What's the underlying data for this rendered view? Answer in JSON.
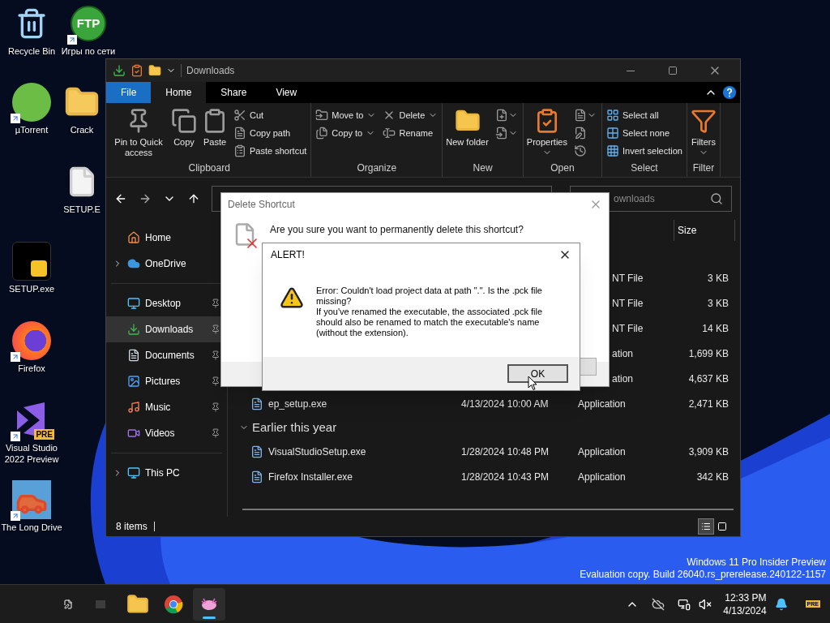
{
  "desktop_icons": [
    {
      "label": "Recycle Bin",
      "kind": "recycle",
      "shortcut": false
    },
    {
      "label": "µTorrent",
      "kind": "torrent",
      "shortcut": true
    },
    {
      "label": "SETUP.exe",
      "kind": "setup",
      "shortcut": false
    },
    {
      "label": "Firefox",
      "kind": "firefox",
      "shortcut": true
    },
    {
      "label": "Visual Studio 2022 Preview",
      "kind": "vs",
      "logo_text": "PRE",
      "shortcut": true
    },
    {
      "label": "The Long Drive",
      "kind": "car",
      "shortcut": true
    },
    {
      "label": "Игры по сети",
      "kind": "ftp",
      "logo_text": "FTP",
      "shortcut": true
    },
    {
      "label": "Crack",
      "kind": "folder",
      "shortcut": false
    },
    {
      "label": "SETUP.E",
      "kind": "file",
      "shortcut": false
    }
  ],
  "explorer": {
    "title": "Downloads",
    "tabs": [
      {
        "label": "File",
        "kind": "file",
        "selected": false
      },
      {
        "label": "Home",
        "kind": "tab",
        "selected": true
      },
      {
        "label": "Share",
        "kind": "tab",
        "selected": false
      },
      {
        "label": "View",
        "kind": "tab",
        "selected": false
      }
    ],
    "ribbon": [
      {
        "label": "Clipboard",
        "items": [
          {
            "kind": "large",
            "label": "Pin to Quick access",
            "dropdown": false
          },
          {
            "kind": "large",
            "label": "Copy",
            "dropdown": false
          },
          {
            "kind": "large",
            "label": "Paste",
            "dropdown": false
          },
          {
            "kind": "small",
            "label": "Cut",
            "dropdown": false
          },
          {
            "kind": "small",
            "label": "Copy path",
            "dropdown": false
          },
          {
            "kind": "small",
            "label": "Paste shortcut",
            "dropdown": false
          }
        ]
      },
      {
        "label": "Organize",
        "items": [
          {
            "kind": "small",
            "label": "Move to",
            "dropdown": true
          },
          {
            "kind": "small",
            "label": "Copy to",
            "dropdown": true
          },
          {
            "kind": "small",
            "label": "Delete",
            "dropdown": true
          },
          {
            "kind": "small",
            "label": "Rename",
            "dropdown": false
          }
        ]
      },
      {
        "label": "New",
        "items": [
          {
            "kind": "large",
            "label": "New folder",
            "dropdown": false
          },
          {
            "kind": "icon",
            "dropdown": true
          },
          {
            "kind": "icon",
            "dropdown": true
          }
        ]
      },
      {
        "label": "Open",
        "items": [
          {
            "kind": "large",
            "label": "Properties",
            "dropdown": true
          },
          {
            "kind": "icon",
            "dropdown": true
          },
          {
            "kind": "icon",
            "dropdown": false
          },
          {
            "kind": "icon",
            "dropdown": false
          }
        ]
      },
      {
        "label": "Select",
        "items": [
          {
            "kind": "small",
            "label": "Select all",
            "dropdown": false
          },
          {
            "kind": "small",
            "label": "Select none",
            "dropdown": false
          },
          {
            "kind": "small",
            "label": "Invert selection",
            "dropdown": false
          }
        ]
      },
      {
        "label": "Filter",
        "items": [
          {
            "kind": "large",
            "label": "Filters",
            "dropdown": true
          }
        ]
      }
    ],
    "search": {
      "placeholder": "ownloads"
    },
    "sidebar": [
      [
        {
          "label": "Home",
          "selected": false,
          "pinned": false
        },
        {
          "label": "OneDrive",
          "selected": false,
          "pinned": false,
          "expanded": false
        }
      ],
      [
        {
          "label": "Desktop",
          "selected": false,
          "pinned": true
        },
        {
          "label": "Downloads",
          "selected": true,
          "pinned": true
        },
        {
          "label": "Documents",
          "selected": false,
          "pinned": true
        },
        {
          "label": "Pictures",
          "selected": false,
          "pinned": true
        },
        {
          "label": "Music",
          "selected": false,
          "pinned": true
        },
        {
          "label": "Videos",
          "selected": false,
          "pinned": true
        }
      ],
      [
        {
          "label": "This PC",
          "selected": false,
          "pinned": false,
          "expanded": false
        }
      ]
    ],
    "size_header": "Size",
    "rows": [
      {
        "kind": "partial",
        "type": "NT File",
        "size": "3 KB"
      },
      {
        "kind": "partial",
        "type": "NT File",
        "size": "3 KB"
      },
      {
        "kind": "partial",
        "type": "NT File",
        "size": "14 KB"
      },
      {
        "kind": "partial",
        "type": "ation",
        "size": "1,699 KB"
      },
      {
        "kind": "partial",
        "type": "ation",
        "size": "4,637 KB"
      },
      {
        "kind": "full",
        "name": "ep_setup.exe",
        "date": "4/13/2024 10:00 AM",
        "type": "Application",
        "size": "2,471 KB"
      }
    ],
    "group": {
      "label": "Earlier this year",
      "expanded": true,
      "rows": [
        {
          "kind": "full",
          "name": "VisualStudioSetup.exe",
          "date": "1/28/2024 10:48 PM",
          "type": "Application",
          "size": "3,909 KB"
        },
        {
          "kind": "full",
          "name": "Firefox Installer.exe",
          "date": "1/28/2024 10:43 PM",
          "type": "Application",
          "size": "342 KB"
        }
      ]
    },
    "status": "8 items",
    "views": [
      {
        "selected": true
      },
      {
        "selected": false
      }
    ]
  },
  "delete_dialog": {
    "title": "Delete Shortcut",
    "question": "Are you sure you want to permanently delete this shortcut?"
  },
  "alert": {
    "title": "ALERT!",
    "message": [
      "Error: Couldn't load project data at path \".\". Is the .pck file missing?",
      "If you've renamed the executable, the associated .pck file should also be renamed to match the executable's name (without the extension)."
    ],
    "button": "OK"
  },
  "build_info": [
    "Windows 11 Pro Insider Preview",
    "Evaluation copy. Build 26040.rs_prerelease.240122-1157"
  ],
  "taskbar": {
    "apps": [
      {
        "kind": "explorer",
        "active": false
      },
      {
        "kind": "chrome",
        "active": false
      },
      {
        "kind": "creature",
        "active": true
      }
    ],
    "time": "12:33 PM",
    "date": "4/13/2024",
    "badge": "PRE"
  }
}
